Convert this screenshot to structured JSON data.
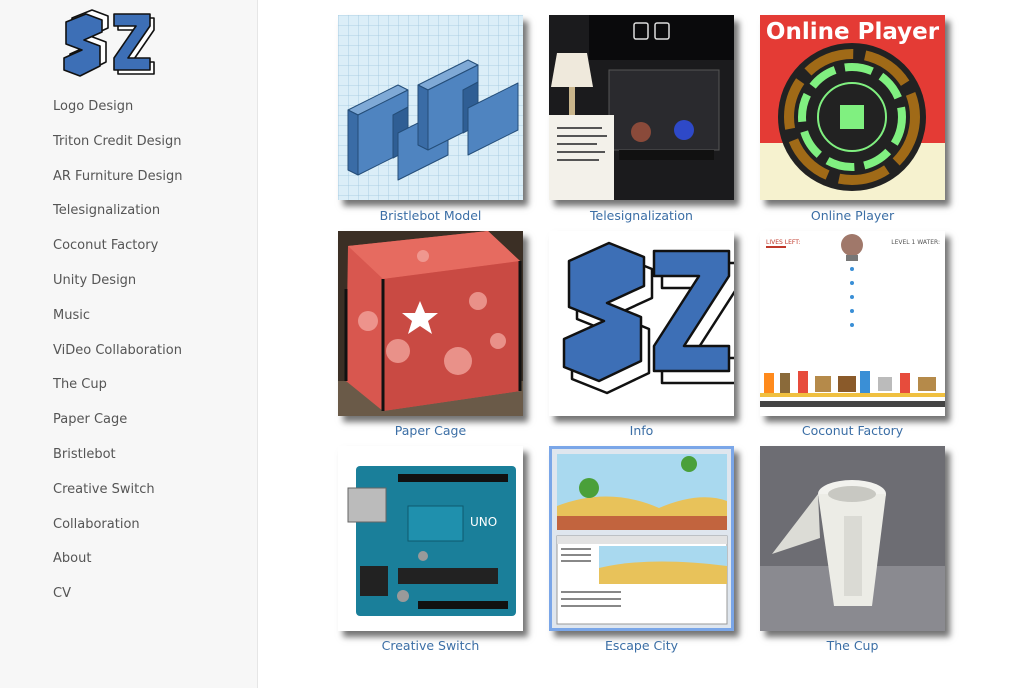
{
  "sidebar": {
    "nav": [
      "Logo Design",
      "Triton Credit Design",
      "AR Furniture Design",
      "Telesignalization",
      "Coconut Factory",
      "Unity Design",
      "Music",
      "ViDeo Collaboration",
      "The Cup",
      "Paper Cage",
      "Bristlebot",
      "Creative Switch",
      "Collaboration",
      "About",
      "CV"
    ]
  },
  "gallery": [
    {
      "caption": "Bristlebot Model"
    },
    {
      "caption": "Telesignalization"
    },
    {
      "caption": "Online Player",
      "image_text": "Online Player"
    },
    {
      "caption": "Paper Cage"
    },
    {
      "caption": "Info"
    },
    {
      "caption": "Coconut Factory",
      "image_text_left": "LIVES LEFT:",
      "image_text_right": "LEVEL 1 WATER:"
    },
    {
      "caption": "Creative Switch",
      "image_text": "UNO"
    },
    {
      "caption": "Escape City"
    },
    {
      "caption": "The Cup"
    }
  ],
  "colors": {
    "link": "#3b6ea5",
    "nav_text": "#555555",
    "sidebar_bg": "#f7f7f7",
    "logo_blue": "#3d6fb6"
  }
}
